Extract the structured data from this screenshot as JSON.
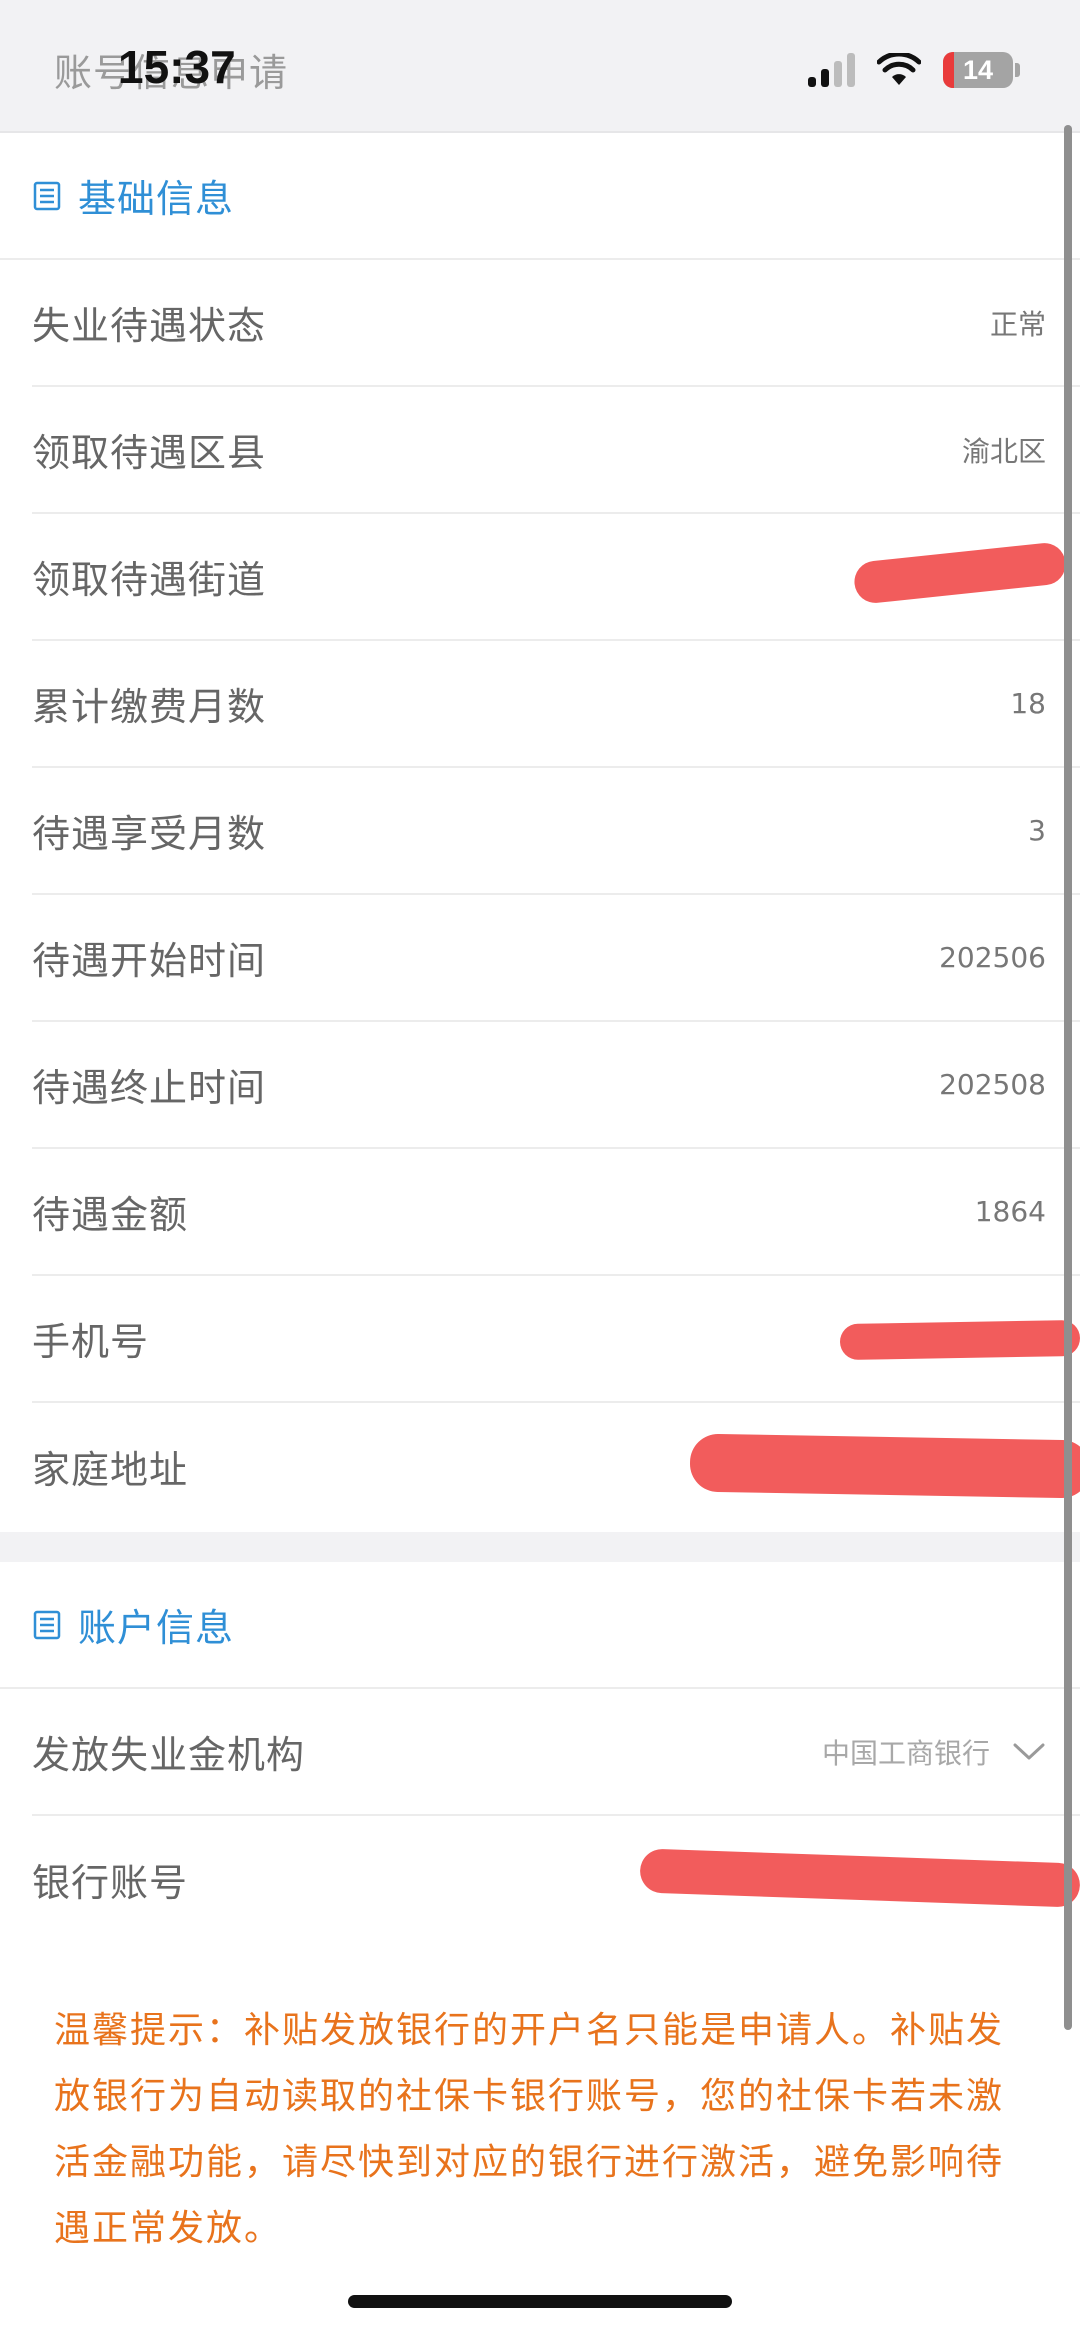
{
  "header": {
    "title": "账号信息申请",
    "time": "15:37",
    "battery": "14"
  },
  "basic_info": {
    "title": "基础信息",
    "rows": [
      {
        "label": "失业待遇状态",
        "value": "正常"
      },
      {
        "label": "领取待遇区县",
        "value": "渝北区"
      },
      {
        "label": "领取待遇街道",
        "value": ""
      },
      {
        "label": "累计缴费月数",
        "value": "18"
      },
      {
        "label": "待遇享受月数",
        "value": "3"
      },
      {
        "label": "待遇开始时间",
        "value": "202506"
      },
      {
        "label": "待遇终止时间",
        "value": "202508"
      },
      {
        "label": "待遇金额",
        "value": "1864"
      },
      {
        "label": "手机号",
        "value": ""
      },
      {
        "label": "家庭地址",
        "value": ""
      }
    ]
  },
  "account_info": {
    "title": "账户信息",
    "rows": [
      {
        "label": "发放失业金机构",
        "value": "中国工商银行"
      },
      {
        "label": "银行账号",
        "value": ""
      }
    ]
  },
  "tip": "温馨提示：补贴发放银行的开户名只能是申请人。补贴发放银行为自动读取的社保卡银行账号，您的社保卡若未激活金融功能，请尽快到对应的银行进行激活，避免影响待遇正常发放。",
  "colors": {
    "accent": "#2f8fd6",
    "warning": "#e8731c",
    "redaction": "#f25c5c"
  }
}
